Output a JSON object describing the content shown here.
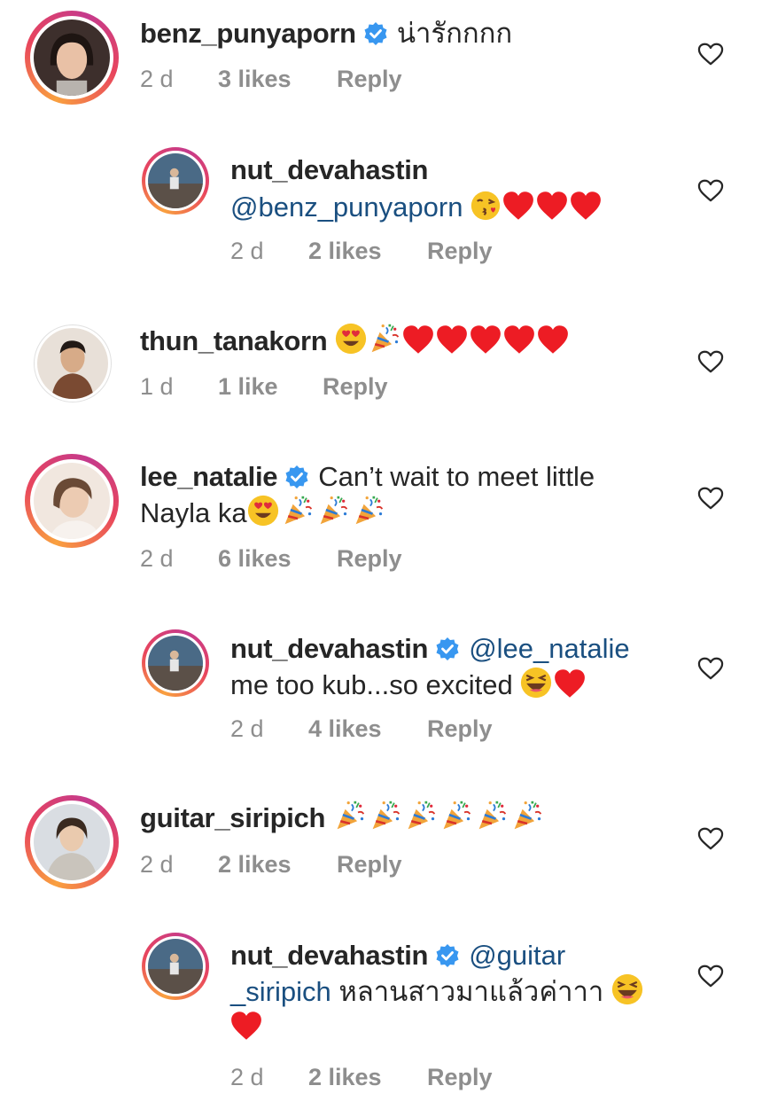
{
  "comments": [
    {
      "username": "benz_punyaporn",
      "verified": true,
      "text": "น่ารักกกก",
      "time": "2 d",
      "likes": "3 likes",
      "reply": "Reply"
    },
    {
      "username": "nut_devahastin",
      "verified": false,
      "mention": "@benz_punyaporn",
      "text": "",
      "time": "2 d",
      "likes": "2 likes",
      "reply": "Reply"
    },
    {
      "username": "thun_tanakorn",
      "verified": false,
      "text": "",
      "time": "1 d",
      "likes": "1 like",
      "reply": "Reply"
    },
    {
      "username": "lee_natalie",
      "verified": true,
      "text_line1": "Can’t wait to meet little",
      "text_line2": "Nayla ka",
      "time": "2 d",
      "likes": "6 likes",
      "reply": "Reply"
    },
    {
      "username": "nut_devahastin",
      "verified": true,
      "mention": "@lee_natalie",
      "text_line2": "me too kub...so excited",
      "time": "2 d",
      "likes": "4 likes",
      "reply": "Reply"
    },
    {
      "username": "guitar_siripich",
      "verified": false,
      "text": "",
      "time": "2 d",
      "likes": "2 likes",
      "reply": "Reply"
    },
    {
      "username": "nut_devahastin",
      "verified": true,
      "mention_part1": "@guitar",
      "mention_part2": "_siripich",
      "text": "หลานสาวมาแล้วค่าาา",
      "time": "2 d",
      "likes": "2 likes",
      "reply": "Reply"
    }
  ],
  "icons": {
    "verified_badge": "verified-badge-icon",
    "like": "heart-outline-icon",
    "emoji_heart": "red-heart-emoji",
    "emoji_kiss": "face-blowing-kiss-emoji",
    "emoji_heart_eyes": "heart-eyes-emoji",
    "emoji_party": "party-popper-emoji",
    "emoji_laugh": "grinning-squinting-emoji"
  },
  "colors": {
    "text": "#262626",
    "meta": "#8e8e8e",
    "mention": "#1a4f80",
    "verified": "#3897f0",
    "heart": "#ed1c24"
  }
}
